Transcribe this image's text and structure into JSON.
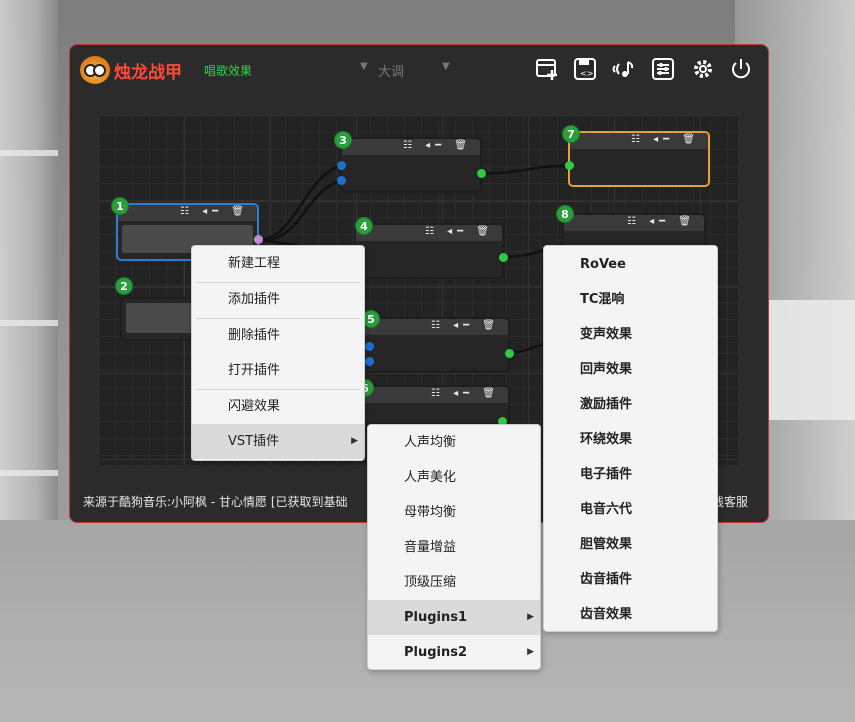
{
  "app": {
    "title": "烛龙战甲",
    "subtitle": "唱歌效果",
    "key_select": {
      "value": "大调",
      "arrow_left": "▼",
      "arrow_right": "▼"
    },
    "toolbar_icons": [
      "new-project-icon",
      "save-icon",
      "audio-icon",
      "mixer-icon",
      "settings-icon",
      "power-icon"
    ]
  },
  "nodes": [
    {
      "number": "1"
    },
    {
      "number": "2"
    },
    {
      "number": "3"
    },
    {
      "number": "4"
    },
    {
      "number": "5"
    },
    {
      "number": "6"
    },
    {
      "number": "7"
    },
    {
      "number": "8"
    }
  ],
  "node_controls": "☷ ◂━ 🗑",
  "status": {
    "left": "来源于酷狗音乐:小阿枫 - 甘心情愿 [已获取到基础",
    "right": "线客服"
  },
  "context_menu": {
    "items": [
      {
        "label": "新建工程"
      },
      {
        "label": "添加插件"
      },
      {
        "label": "删除插件"
      },
      {
        "label": "打开插件"
      },
      {
        "label": "闪避效果"
      },
      {
        "label": "VST插件",
        "arrow": "▶"
      }
    ]
  },
  "vst_submenu": {
    "items": [
      {
        "label": "人声均衡"
      },
      {
        "label": "人声美化"
      },
      {
        "label": "母带均衡"
      },
      {
        "label": "音量增益"
      },
      {
        "label": "顶级压缩"
      },
      {
        "label": "Plugins1",
        "arrow": "▶"
      },
      {
        "label": "Plugins2",
        "arrow": "▶"
      }
    ]
  },
  "plugins1_submenu": {
    "items": [
      {
        "label": "RoVee"
      },
      {
        "label": "TC混响"
      },
      {
        "label": "变声效果"
      },
      {
        "label": "回声效果"
      },
      {
        "label": "激励插件"
      },
      {
        "label": "环绕效果"
      },
      {
        "label": "电子插件"
      },
      {
        "label": "电音六代"
      },
      {
        "label": "胆管效果"
      },
      {
        "label": "齿音插件"
      },
      {
        "label": "齿音效果"
      }
    ]
  },
  "colors": {
    "accent_red": "#ff4a3a",
    "accent_green": "#27d64a",
    "badge_green": "#2a9e3c",
    "selected_blue": "#2a7fd0",
    "selected_orange": "#e5a03a"
  }
}
